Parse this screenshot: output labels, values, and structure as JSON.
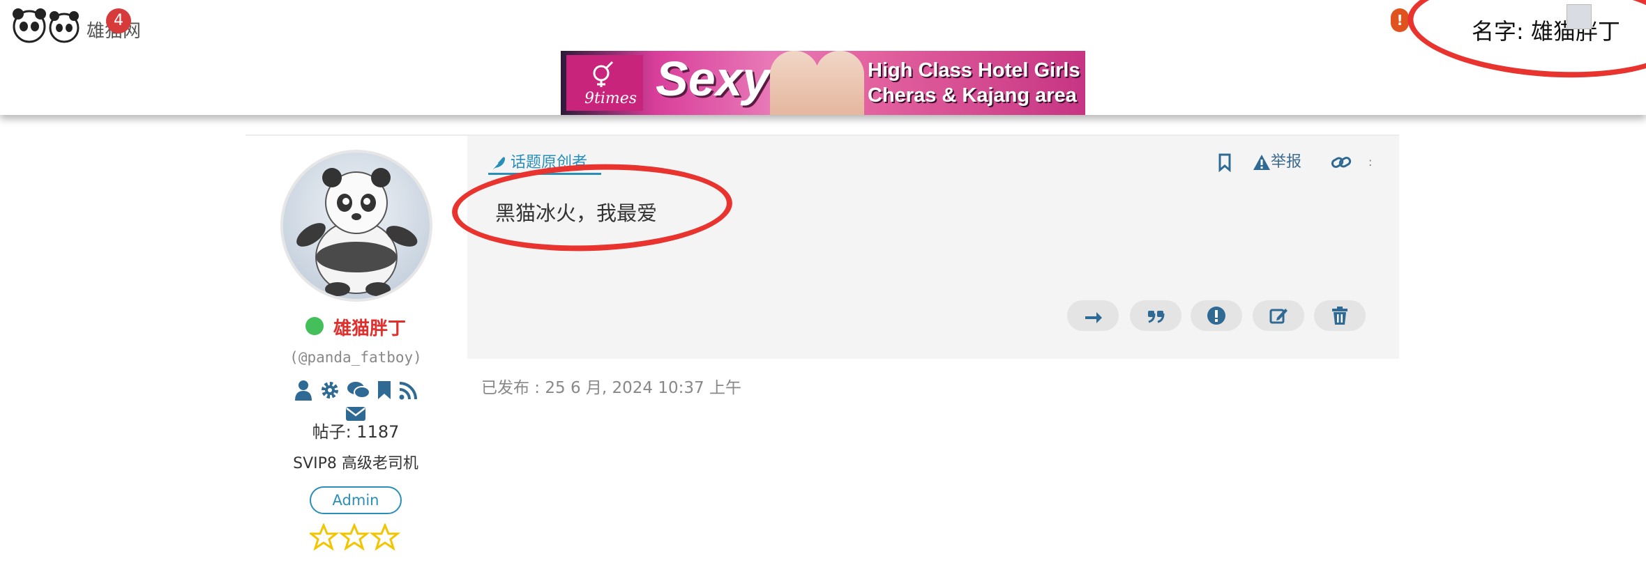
{
  "header": {
    "logo_text": "雄猫网",
    "notification_count": "4",
    "alert_symbol": "!",
    "user_label": "名字: 雄猫胖丁"
  },
  "banner": {
    "brand": "9times",
    "headline": "Sexy",
    "line1": "High Class Hotel Girls",
    "line2": "Cheras & Kajang area"
  },
  "post": {
    "op_tag": "话题原创者",
    "report_label": "举报",
    "more_label": ":",
    "content": "黑猫冰火，我最爱",
    "published": "已发布 : 25 6 月, 2024 10:37 上午"
  },
  "author": {
    "name": "雄猫胖丁",
    "handle": "(@panda_fatboy)",
    "posts": "帖子: 1187",
    "rank": "SVIP8 高级老司机",
    "role": "Admin"
  },
  "colors": {
    "accent": "#2a8fb8",
    "name_red": "#e0302e",
    "online": "#43c05a",
    "star": "#f2c500",
    "annotation": "#e8332e"
  }
}
